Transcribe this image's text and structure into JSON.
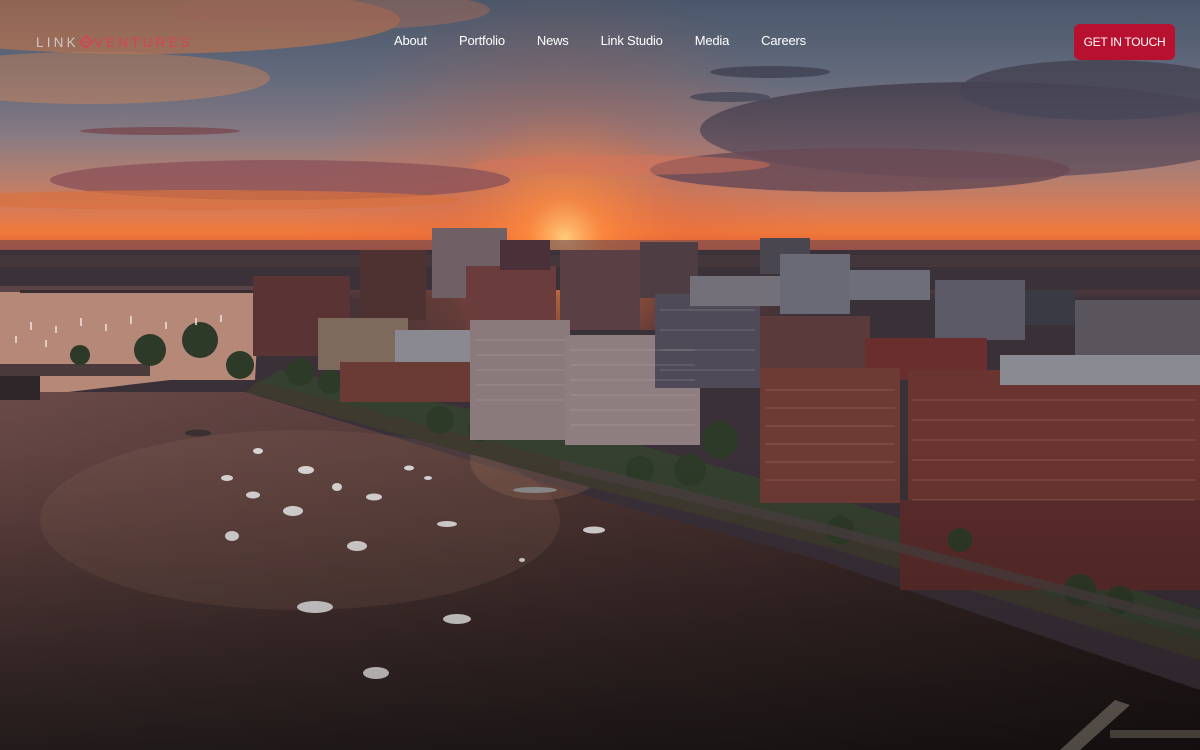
{
  "brand": {
    "logo_link": "LINK",
    "logo_ventures": "VENTURES",
    "accent_color": "#b8112f"
  },
  "nav": {
    "items": [
      {
        "label": "About"
      },
      {
        "label": "Portfolio"
      },
      {
        "label": "News"
      },
      {
        "label": "Link Studio"
      },
      {
        "label": "Media"
      },
      {
        "label": "Careers"
      }
    ]
  },
  "cta": {
    "label": "GET IN TOUCH"
  },
  "hero": {
    "image_semantic": "aerial-sunset-cityscape-river"
  }
}
